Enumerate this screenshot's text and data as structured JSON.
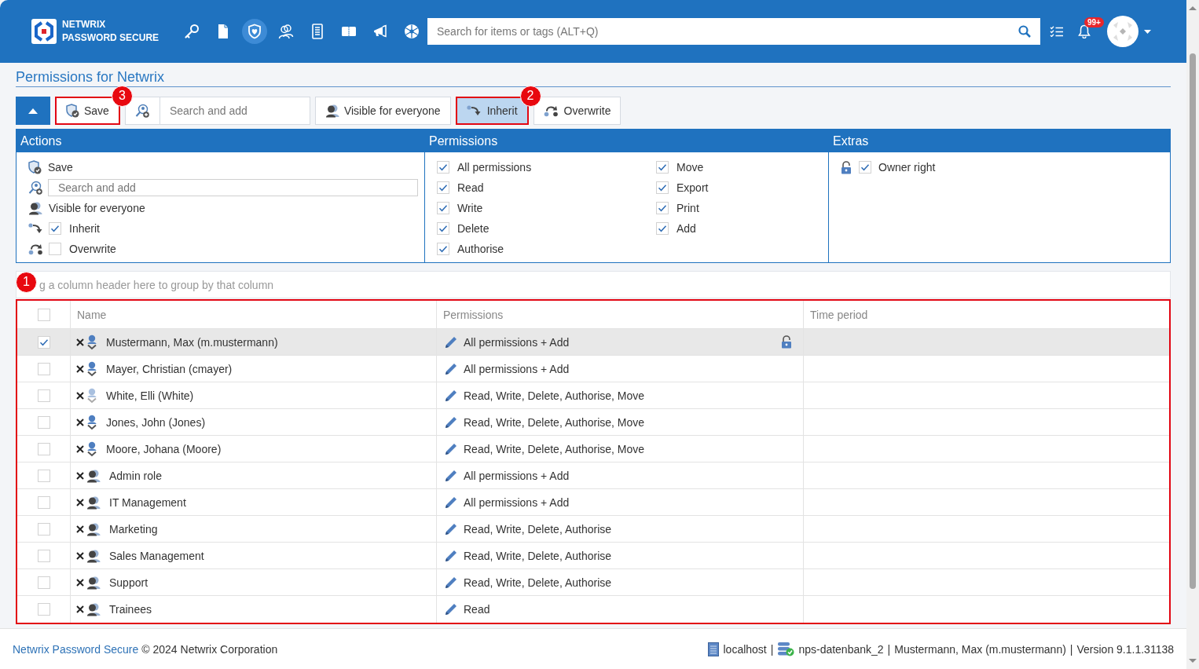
{
  "header": {
    "logo": {
      "line_1": "NETWRIX",
      "line_2": "PASSWORD SECURE"
    },
    "modules": [
      {
        "selected": false
      },
      {
        "selected": false
      },
      {
        "selected": true
      },
      {
        "selected": false
      },
      {
        "selected": false
      },
      {
        "selected": false
      },
      {
        "selected": false
      },
      {
        "selected": false
      }
    ],
    "search": {
      "placeholder": "Search for items or tags (ALT+Q)"
    },
    "notifications": {
      "badge": "99+"
    }
  },
  "page_title": "Permissions for Netwrix",
  "toolbar": [
    {
      "kind": "collapse"
    },
    {
      "kind": "button",
      "label": "Save",
      "selected": false,
      "callout": "3"
    },
    {
      "kind": "search",
      "placeholder": "Search and add"
    },
    {
      "kind": "button",
      "label": "Visible for everyone",
      "selected": false
    },
    {
      "kind": "toggle",
      "label": "Inherit",
      "selected": true,
      "callout": "2"
    },
    {
      "kind": "toggle",
      "label": "Overwrite",
      "selected": false
    }
  ],
  "panel": {
    "actions": {
      "title": "Actions",
      "items": [
        {
          "kind": "action",
          "label": "Save"
        },
        {
          "kind": "search",
          "placeholder": "Search and add"
        },
        {
          "kind": "action",
          "label": "Visible for everyone"
        },
        {
          "kind": "check",
          "label": "Inherit",
          "checked": true
        },
        {
          "kind": "check",
          "label": "Overwrite",
          "checked": false
        }
      ]
    },
    "permissions": {
      "title": "Permissions",
      "items": [
        {
          "label": "All permissions",
          "checked": true
        },
        {
          "label": "Read",
          "checked": true
        },
        {
          "label": "Write",
          "checked": true
        },
        {
          "label": "Delete",
          "checked": true
        },
        {
          "label": "Authorise",
          "checked": true
        },
        {
          "label": "Move",
          "checked": true
        },
        {
          "label": "Export",
          "checked": true
        },
        {
          "label": "Print",
          "checked": true
        },
        {
          "label": "Add",
          "checked": true
        }
      ]
    },
    "extras": {
      "title": "Extras",
      "items": [
        {
          "label": "Owner right",
          "checked": true
        }
      ]
    }
  },
  "group_panel": {
    "hint": "g a column header here to group by that column"
  },
  "table": {
    "callout": "1",
    "select_all": {
      "checked": false
    },
    "columns": [
      "Name",
      "Permissions",
      "Time period"
    ],
    "rows": [
      {
        "selected": true,
        "kind": "user",
        "disabled": false,
        "name": "Mustermann, Max (m.mustermann)",
        "permissions": "All permissions + Add",
        "owner": true
      },
      {
        "selected": false,
        "kind": "user",
        "disabled": false,
        "name": "Mayer, Christian (cmayer)",
        "permissions": "All permissions + Add",
        "owner": false
      },
      {
        "selected": false,
        "kind": "user",
        "disabled": true,
        "name": "White, Elli (White)",
        "permissions": "Read, Write, Delete, Authorise, Move",
        "owner": false
      },
      {
        "selected": false,
        "kind": "user",
        "disabled": false,
        "name": "Jones, John (Jones)",
        "permissions": "Read, Write, Delete, Authorise, Move",
        "owner": false
      },
      {
        "selected": false,
        "kind": "user",
        "disabled": false,
        "name": "Moore, Johana (Moore)",
        "permissions": "Read, Write, Delete, Authorise, Move",
        "owner": false
      },
      {
        "selected": false,
        "kind": "role",
        "disabled": false,
        "name": "Admin role",
        "permissions": "All permissions + Add",
        "owner": false
      },
      {
        "selected": false,
        "kind": "role",
        "disabled": false,
        "name": "IT Management",
        "permissions": "All permissions + Add",
        "owner": false
      },
      {
        "selected": false,
        "kind": "role",
        "disabled": false,
        "name": "Marketing",
        "permissions": "Read, Write, Delete, Authorise",
        "owner": false
      },
      {
        "selected": false,
        "kind": "role",
        "disabled": false,
        "name": "Sales Management",
        "permissions": "Read, Write, Delete, Authorise",
        "owner": false
      },
      {
        "selected": false,
        "kind": "role",
        "disabled": false,
        "name": "Support",
        "permissions": "Read, Write, Delete, Authorise",
        "owner": false
      },
      {
        "selected": false,
        "kind": "role",
        "disabled": false,
        "name": "Trainees",
        "permissions": "Read",
        "owner": false
      }
    ]
  },
  "footer": {
    "product_link": "Netwrix Password Secure",
    "copyright": "© 2024 Netwrix Corporation",
    "status": [
      {
        "kind": "server",
        "text": "localhost"
      },
      {
        "kind": "separator",
        "text": "|"
      },
      {
        "kind": "database",
        "text": "nps-datenbank_2"
      },
      {
        "kind": "separator",
        "text": "|"
      },
      {
        "kind": "text",
        "text": "Mustermann, Max (m.mustermann)"
      },
      {
        "kind": "separator",
        "text": "|"
      },
      {
        "kind": "text",
        "text": "Version 9.1.1.31138"
      }
    ]
  }
}
